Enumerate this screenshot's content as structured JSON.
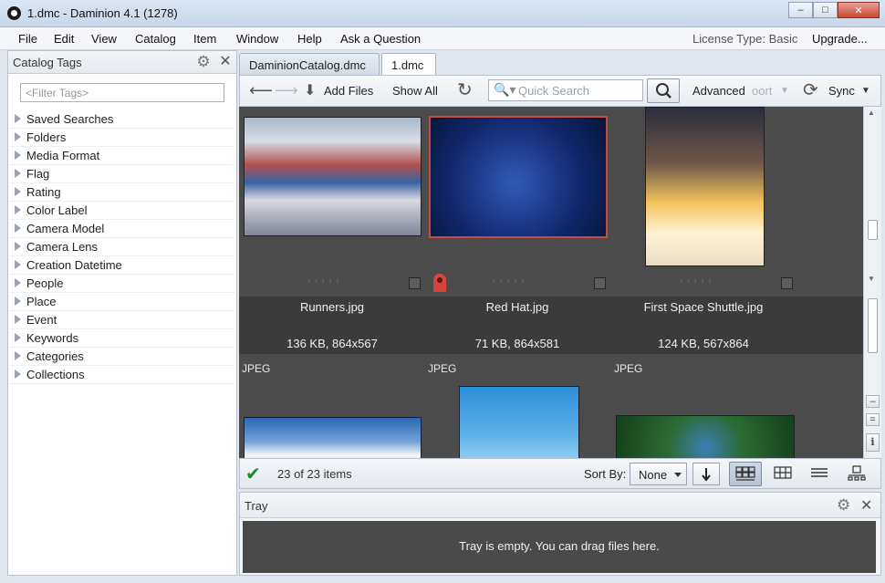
{
  "window": {
    "title": "1.dmc - Daminion 4.1 (1278)",
    "minimize": "–",
    "maximize": "□",
    "close": "✕"
  },
  "menu": {
    "items": [
      "File",
      "Edit",
      "View",
      "Catalog",
      "Item",
      "Window",
      "Help",
      "Ask a Question"
    ],
    "license": "License Type: Basic",
    "upgrade": "Upgrade..."
  },
  "catalog_tags": {
    "title": "Catalog Tags",
    "filter_placeholder": "<Filter Tags>",
    "items": [
      "Saved Searches",
      "Folders",
      "Media Format",
      "Flag",
      "Rating",
      "Color Label",
      "Camera Model",
      "Camera Lens",
      "Creation Datetime",
      "People",
      "Place",
      "Event",
      "Keywords",
      "Categories",
      "Collections"
    ]
  },
  "tabs": [
    "DaminionCatalog.dmc",
    "1.dmc"
  ],
  "toolbar": {
    "add_files": "Add Files",
    "show_all": "Show All",
    "search_placeholder": "Quick Search",
    "advanced": "Advanced",
    "export_partial": "oort",
    "sync": "Sync"
  },
  "items": [
    {
      "name": "Runners.jpg",
      "size": "136 KB, 864x567",
      "type": "JPEG"
    },
    {
      "name": "Red Hat.jpg",
      "size": "71 KB, 864x581",
      "type": "JPEG"
    },
    {
      "name": "First Space Shuttle.jpg",
      "size": "124 KB, 567x864",
      "type": "JPEG"
    }
  ],
  "status": {
    "count": "23 of 23 items",
    "sort_label": "Sort By:",
    "sort_value": "None"
  },
  "tray": {
    "title": "Tray",
    "empty_message": "Tray is empty. You can drag files here."
  },
  "colors": {
    "browser_bg": "#4a4a4a",
    "selection": "#c64a45",
    "ok_check": "#1d8a2e"
  }
}
